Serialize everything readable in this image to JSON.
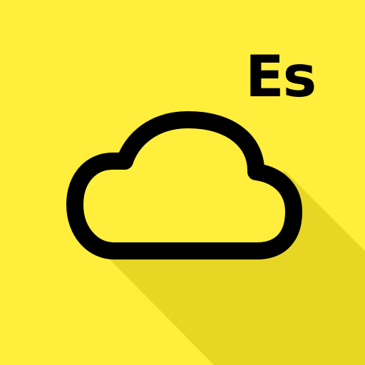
{
  "icon": {
    "name": "cloud-icon",
    "badge_text": "Es"
  },
  "colors": {
    "background": "#ffee3b",
    "long_shadow": "#e8d625",
    "outline": "#000000",
    "cloud_fill": "#ffee3b"
  }
}
